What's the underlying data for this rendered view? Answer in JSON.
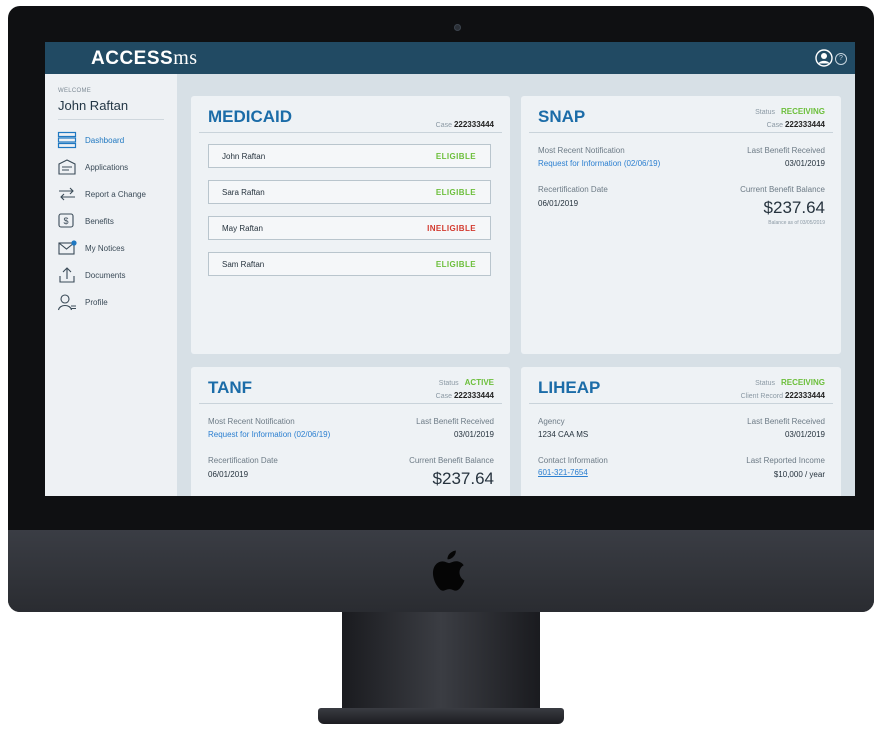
{
  "header": {
    "logo_text": "ACCESS",
    "logo_suffix": "ms",
    "help_glyph": "?"
  },
  "sidebar": {
    "welcome": "WELCOME",
    "user_name": "John Raftan",
    "items": [
      {
        "label": "Dashboard",
        "icon": "dashboard-icon",
        "active": true
      },
      {
        "label": "Applications",
        "icon": "applications-icon"
      },
      {
        "label": "Report a Change",
        "icon": "report-change-icon"
      },
      {
        "label": "Benefits",
        "icon": "benefits-icon"
      },
      {
        "label": "My Notices",
        "icon": "notices-icon"
      },
      {
        "label": "Documents",
        "icon": "documents-icon"
      },
      {
        "label": "Profile",
        "icon": "profile-icon"
      }
    ]
  },
  "medicaid": {
    "title": "MEDICAID",
    "case_label": "Case",
    "case_number": "222333444",
    "members": [
      {
        "name": "John Raftan",
        "status": "ELIGIBLE"
      },
      {
        "name": "Sara Raftan",
        "status": "ELIGIBLE"
      },
      {
        "name": "May Raftan",
        "status": "INELIGIBLE"
      },
      {
        "name": "Sam Raftan",
        "status": "ELIGIBLE"
      }
    ]
  },
  "snap": {
    "title": "SNAP",
    "status_label": "Status",
    "status": "RECEIVING",
    "case_label": "Case",
    "case_number": "222333444",
    "notification_label": "Most Recent Notification",
    "notification_link": "Request for Information (02/06/19)",
    "last_benefit_label": "Last Benefit Received",
    "last_benefit_date": "03/01/2019",
    "recert_label": "Recertification Date",
    "recert_date": "06/01/2019",
    "balance_label": "Current Benefit Balance",
    "balance": "$237.64",
    "balance_note": "Balance as of 03/05/2019"
  },
  "tanf": {
    "title": "TANF",
    "status_label": "Status",
    "status": "ACTIVE",
    "case_label": "Case",
    "case_number": "222333444",
    "notification_label": "Most Recent Notification",
    "notification_link": "Request for Information (02/06/19)",
    "last_benefit_label": "Last Benefit Received",
    "last_benefit_date": "03/01/2019",
    "recert_label": "Recertification Date",
    "recert_date": "06/01/2019",
    "balance_label": "Current Benefit Balance",
    "balance": "$237.64"
  },
  "liheap": {
    "title": "LIHEAP",
    "status_label": "Status",
    "status": "RECEIVING",
    "record_label": "Client Record",
    "record_number": "222333444",
    "agency_label": "Agency",
    "agency": "1234 CAA MS",
    "contact_label": "Contact Information",
    "contact_phone": "601-321-7654",
    "last_benefit_label": "Last Benefit Received",
    "last_benefit_date": "03/01/2019",
    "income_label": "Last Reported Income",
    "income": "$10,000 / year"
  },
  "colors": {
    "brand": "#214a63",
    "accent": "#1b6ca8",
    "eligible": "#6cbf3b",
    "ineligible": "#d33a2f",
    "link": "#2b7fd0"
  }
}
